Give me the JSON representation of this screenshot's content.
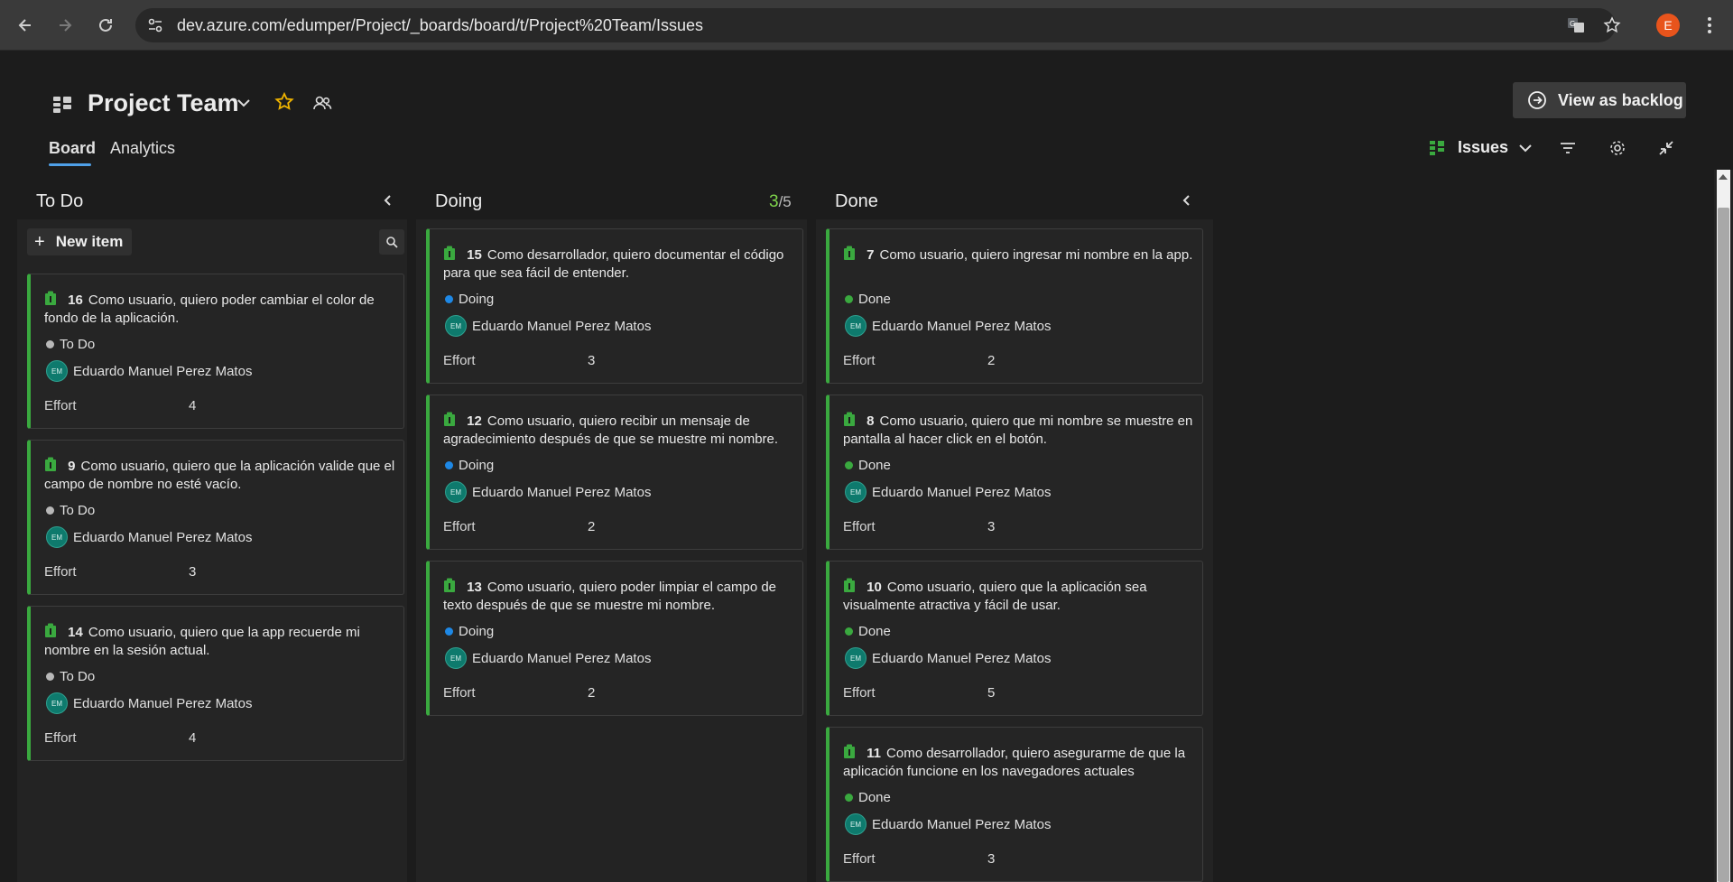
{
  "browser": {
    "url": "dev.azure.com/edumper/Project/_boards/board/t/Project%20Team/Issues",
    "profile_initial": "E"
  },
  "header": {
    "team_name": "Project Team",
    "view_as_backlog": "View as backlog",
    "tabs": [
      "Board",
      "Analytics"
    ],
    "backlog_level": "Issues"
  },
  "columns": {
    "todo": {
      "title": "To Do",
      "new_item": "New item"
    },
    "doing": {
      "title": "Doing",
      "wip_current": "3",
      "wip_max": "/5"
    },
    "done": {
      "title": "Done"
    }
  },
  "effort_label": "Effort",
  "cards": {
    "todo": [
      {
        "id": "16",
        "title": "Como usuario, quiero poder cambiar el color de fondo de la aplicación.",
        "state": "To Do",
        "assignee": "Eduardo Manuel Perez Matos",
        "initials": "EM",
        "effort": "4"
      },
      {
        "id": "9",
        "title": "Como usuario, quiero que la aplicación valide que el campo de nombre no esté vacío.",
        "state": "To Do",
        "assignee": "Eduardo Manuel Perez Matos",
        "initials": "EM",
        "effort": "3"
      },
      {
        "id": "14",
        "title": "Como usuario, quiero que la app recuerde mi nombre en la sesión actual.",
        "state": "To Do",
        "assignee": "Eduardo Manuel Perez Matos",
        "initials": "EM",
        "effort": "4"
      }
    ],
    "doing": [
      {
        "id": "15",
        "title": "Como desarrollador, quiero documentar el código para que sea fácil de entender.",
        "state": "Doing",
        "assignee": "Eduardo Manuel Perez Matos",
        "initials": "EM",
        "effort": "3"
      },
      {
        "id": "12",
        "title": "Como usuario, quiero recibir un mensaje de agradecimiento después de que se muestre mi nombre.",
        "state": "Doing",
        "assignee": "Eduardo Manuel Perez Matos",
        "initials": "EM",
        "effort": "2"
      },
      {
        "id": "13",
        "title": "Como usuario, quiero poder limpiar el campo de texto después de que se muestre mi nombre.",
        "state": "Doing",
        "assignee": "Eduardo Manuel Perez Matos",
        "initials": "EM",
        "effort": "2"
      }
    ],
    "done": [
      {
        "id": "7",
        "title": "Como usuario, quiero ingresar mi nombre en la app.",
        "state": "Done",
        "assignee": "Eduardo Manuel Perez Matos",
        "initials": "EM",
        "effort": "2"
      },
      {
        "id": "8",
        "title": "Como usuario, quiero que mi nombre se muestre en pantalla al hacer click en el botón.",
        "state": "Done",
        "assignee": "Eduardo Manuel Perez Matos",
        "initials": "EM",
        "effort": "3"
      },
      {
        "id": "10",
        "title": "Como usuario, quiero que la aplicación sea visualmente atractiva y fácil de usar.",
        "state": "Done",
        "assignee": "Eduardo Manuel Perez Matos",
        "initials": "EM",
        "effort": "5"
      },
      {
        "id": "11",
        "title": "Como desarrollador, quiero asegurarme de que la aplicación funcione en los navegadores actuales",
        "state": "Done",
        "assignee": "Eduardo Manuel Perez Matos",
        "initials": "EM",
        "effort": "3"
      }
    ]
  },
  "colors": {
    "card_accent": "#3aa93f",
    "state_todo": "#b8b8b8",
    "state_doing": "#1e88e5",
    "state_done": "#3aa93f",
    "wip_ok": "#7ed34b",
    "tab_underline": "#4fa0e8"
  },
  "icons": {
    "work_item": "bug-icon",
    "team": "team-board-icon",
    "favorite": "star-icon",
    "members": "team-members-icon"
  }
}
